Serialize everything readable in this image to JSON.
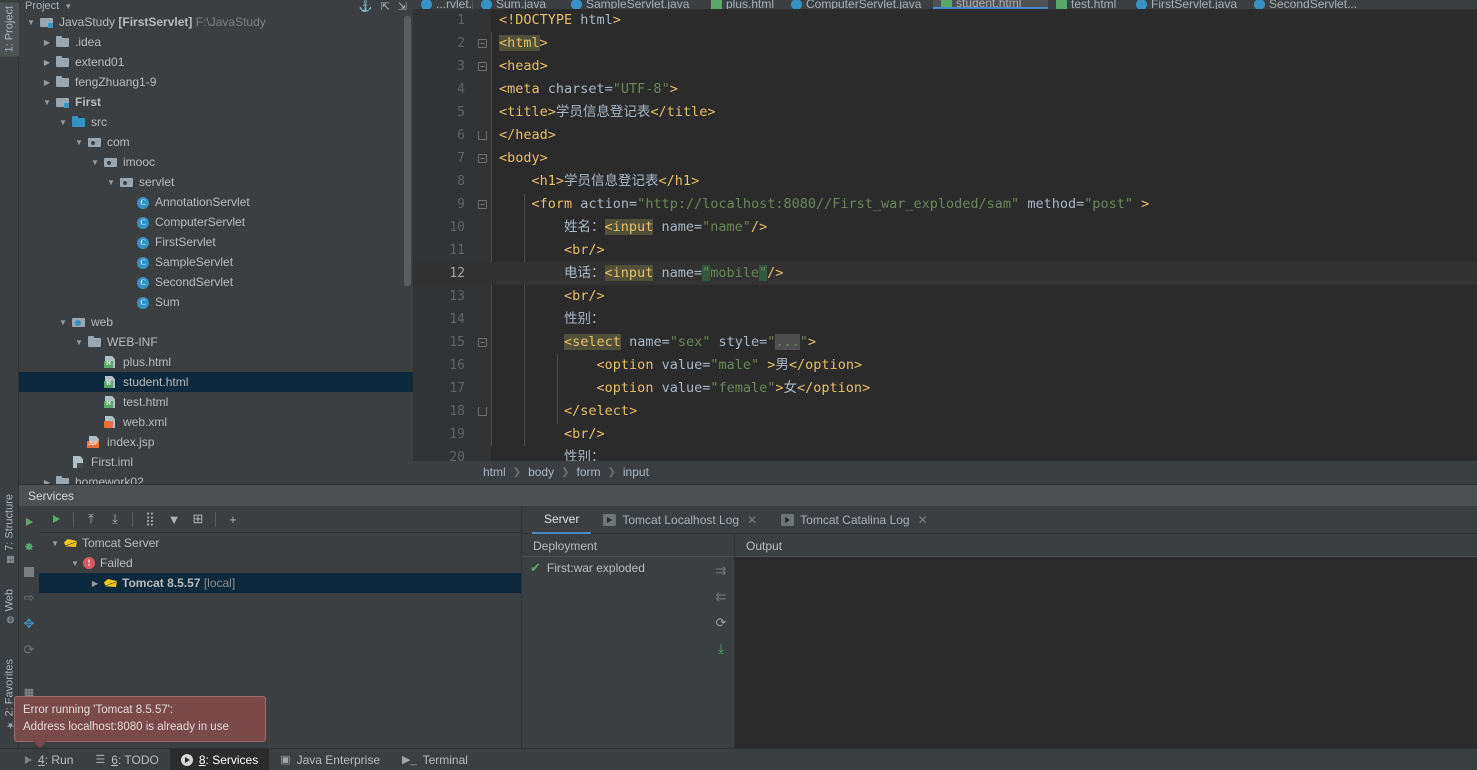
{
  "left_strip": {
    "top_tab": {
      "label": "1: Project",
      "selected": true
    },
    "bottom_tabs": [
      {
        "label": "7: Structure",
        "icon": "structure-icon"
      },
      {
        "label": "Web",
        "icon": "web-icon"
      },
      {
        "label": "2: Favorites",
        "icon": "star-icon"
      }
    ]
  },
  "project": {
    "title": "Project",
    "tree": [
      {
        "indent": 0,
        "arrow": "down",
        "icon": "module-icon",
        "label": "JavaStudy ",
        "bold": "[FirstServlet]",
        "dim": "F:\\JavaStudy"
      },
      {
        "indent": 1,
        "arrow": "right",
        "icon": "folder-icon",
        "label": ".idea"
      },
      {
        "indent": 1,
        "arrow": "right",
        "icon": "folder-icon",
        "label": "extend01"
      },
      {
        "indent": 1,
        "arrow": "right",
        "icon": "folder-icon",
        "label": "fengZhuang1-9"
      },
      {
        "indent": 1,
        "arrow": "down",
        "icon": "module-icon",
        "label": "First",
        "boldLabel": true
      },
      {
        "indent": 2,
        "arrow": "down",
        "icon": "folder-blue-icon",
        "label": "src"
      },
      {
        "indent": 3,
        "arrow": "down",
        "icon": "package-icon",
        "label": "com"
      },
      {
        "indent": 4,
        "arrow": "down",
        "icon": "package-icon",
        "label": "imooc"
      },
      {
        "indent": 5,
        "arrow": "down",
        "icon": "package-icon",
        "label": "servlet"
      },
      {
        "indent": 6,
        "arrow": "none",
        "icon": "java-class-icon",
        "label": "AnnotationServlet"
      },
      {
        "indent": 6,
        "arrow": "none",
        "icon": "java-class-icon",
        "label": "ComputerServlet"
      },
      {
        "indent": 6,
        "arrow": "none",
        "icon": "java-class-icon",
        "label": "FirstServlet"
      },
      {
        "indent": 6,
        "arrow": "none",
        "icon": "java-class-icon",
        "label": "SampleServlet"
      },
      {
        "indent": 6,
        "arrow": "none",
        "icon": "java-class-icon",
        "label": "SecondServlet"
      },
      {
        "indent": 6,
        "arrow": "none",
        "icon": "java-class-icon",
        "label": "Sum"
      },
      {
        "indent": 2,
        "arrow": "down",
        "icon": "web-root-icon",
        "label": "web"
      },
      {
        "indent": 3,
        "arrow": "down",
        "icon": "folder-icon",
        "label": "WEB-INF"
      },
      {
        "indent": 4,
        "arrow": "none",
        "icon": "html-file-icon",
        "label": "plus.html"
      },
      {
        "indent": 4,
        "arrow": "none",
        "icon": "html-file-icon",
        "label": "student.html",
        "selected": true
      },
      {
        "indent": 4,
        "arrow": "none",
        "icon": "html-file-icon",
        "label": "test.html"
      },
      {
        "indent": 4,
        "arrow": "none",
        "icon": "xml-file-icon",
        "label": "web.xml"
      },
      {
        "indent": 3,
        "arrow": "none",
        "icon": "jsp-file-icon",
        "label": "index.jsp"
      },
      {
        "indent": 2,
        "arrow": "none",
        "icon": "iml-file-icon",
        "label": "First.iml"
      },
      {
        "indent": 1,
        "arrow": "right",
        "icon": "folder-icon",
        "label": "homework02"
      }
    ]
  },
  "editor_tabs": [
    {
      "label": "...rvlet.java",
      "icon": "java-class-icon",
      "active": false
    },
    {
      "label": "Sum.java",
      "icon": "java-class-icon",
      "active": false
    },
    {
      "label": "SampleServlet.java",
      "icon": "java-class-icon",
      "active": false
    },
    {
      "label": "plus.html",
      "icon": "html-file-icon",
      "active": false
    },
    {
      "label": "ComputerServlet.java",
      "icon": "java-class-icon",
      "active": false
    },
    {
      "label": "student.html",
      "icon": "html-file-icon",
      "active": true
    },
    {
      "label": "test.html",
      "icon": "html-file-icon",
      "active": false
    },
    {
      "label": "FirstServlet.java",
      "icon": "java-class-icon",
      "active": false
    },
    {
      "label": "SecondServlet...",
      "icon": "java-class-icon",
      "active": false
    }
  ],
  "code": {
    "current_line": 12,
    "lines": [
      {
        "n": 1,
        "text": "<!DOCTYPE html>"
      },
      {
        "n": 2,
        "text": "<html>",
        "fold": "minus"
      },
      {
        "n": 3,
        "text": "<head>",
        "fold": "minus"
      },
      {
        "n": 4,
        "text": "<meta charset=\"UTF-8\">"
      },
      {
        "n": 5,
        "text": "<title>学员信息登记表</title>"
      },
      {
        "n": 6,
        "text": "</head>",
        "fold": "end"
      },
      {
        "n": 7,
        "text": "<body>",
        "fold": "minus"
      },
      {
        "n": 8,
        "text": "    <h1>学员信息登记表</h1>"
      },
      {
        "n": 9,
        "text": "    <form action=\"http://localhost:8080//First_war_exploded/sam\" method=\"post\" >",
        "fold": "minus"
      },
      {
        "n": 10,
        "text": "        姓名：<input name=\"name\"/>"
      },
      {
        "n": 11,
        "text": "        <br/>"
      },
      {
        "n": 12,
        "text": "        电话：<input name=\"mobile\"/>"
      },
      {
        "n": 13,
        "text": "        <br/>"
      },
      {
        "n": 14,
        "text": "        性别："
      },
      {
        "n": 15,
        "text": "        <select name=\"sex\" style=\"...\">",
        "fold": "minus"
      },
      {
        "n": 16,
        "text": "            <option value=\"male\" >男</option>"
      },
      {
        "n": 17,
        "text": "            <option value=\"female\">女</option>"
      },
      {
        "n": 18,
        "text": "        </select>",
        "fold": "end"
      },
      {
        "n": 19,
        "text": "        <br/>"
      },
      {
        "n": 20,
        "text": "        性别："
      }
    ]
  },
  "breadcrumb": [
    "html",
    "body",
    "form",
    "input"
  ],
  "services": {
    "title": "Services",
    "toolbar_buttons": [
      {
        "name": "run-button",
        "glyph": "▶"
      },
      {
        "name": "expand-all-button",
        "glyph": "⤒"
      },
      {
        "name": "collapse-all-button",
        "glyph": "⤓"
      },
      {
        "name": "group-by-button",
        "glyph": "⣿"
      },
      {
        "name": "filter-button",
        "glyph": "▼"
      },
      {
        "name": "add-tab-button",
        "glyph": "⊞"
      },
      {
        "name": "add-service-button",
        "glyph": "+"
      }
    ],
    "sidebar_buttons": [
      {
        "name": "run-button",
        "glyph": "▶"
      },
      {
        "name": "debug-button",
        "glyph": "🐞"
      },
      {
        "name": "stop-button",
        "glyph": "■"
      },
      {
        "name": "deploy-button",
        "glyph": "⇨"
      },
      {
        "name": "update-button",
        "glyph": "✥"
      },
      {
        "name": "restart-button",
        "glyph": "⟳"
      },
      {
        "name": "layout-button",
        "glyph": "▦"
      }
    ],
    "tree": [
      {
        "indent": 0,
        "arrow": "down",
        "icon": "tomcat-icon",
        "label": "Tomcat Server"
      },
      {
        "indent": 1,
        "arrow": "down",
        "icon": "error-icon",
        "label": "Failed"
      },
      {
        "indent": 2,
        "arrow": "right",
        "icon": "tomcat-icon",
        "label": "Tomcat 8.5.57",
        "dim": "[local]",
        "bold": true,
        "selected": true
      }
    ],
    "tabs": [
      {
        "label": "Server",
        "active": true,
        "closable": false
      },
      {
        "label": "Tomcat Localhost Log",
        "active": false,
        "closable": true,
        "icon": "run-tab-icon"
      },
      {
        "label": "Tomcat Catalina Log",
        "active": false,
        "closable": true,
        "icon": "run-tab-icon"
      }
    ],
    "deployment": {
      "title": "Deployment",
      "items": [
        {
          "label": "First:war exploded",
          "status": "ok"
        }
      ],
      "tool_buttons": [
        {
          "name": "deploy-all-icon",
          "glyph": "⇉"
        },
        {
          "name": "undeploy-icon",
          "glyph": "⇇"
        },
        {
          "name": "redeploy-icon",
          "glyph": "⟳"
        },
        {
          "name": "download-icon",
          "glyph": "⤓"
        }
      ]
    },
    "output": {
      "title": "Output",
      "text": ""
    }
  },
  "tooltip": {
    "line1": "Error running 'Tomcat 8.5.57':",
    "line2": "Address localhost:8080 is already in use"
  },
  "statusbar": [
    {
      "label": "4: Run",
      "num": "4",
      "rest": ": Run",
      "icon": "play-icon",
      "active": false
    },
    {
      "label": "6: TODO",
      "num": "6",
      "rest": ": TODO",
      "icon": "todo-icon",
      "active": false
    },
    {
      "label": "8: Services",
      "num": "8",
      "rest": ": Services",
      "icon": "services-icon",
      "active": true
    },
    {
      "label": "Java Enterprise",
      "num": "",
      "rest": "Java Enterprise",
      "icon": "java-ee-icon",
      "active": false
    },
    {
      "label": "Terminal",
      "num": "",
      "rest": "Terminal",
      "icon": "terminal-icon",
      "active": false
    }
  ],
  "colors": {
    "bg": "#3c3f41",
    "editor_bg": "#2b2b2b",
    "selection": "#0d293e",
    "accent": "#4a88c7",
    "error": "#db5860",
    "ok": "#59a869",
    "tag": "#e8bf6a",
    "string": "#6a8759",
    "text": "#a9b7c6"
  }
}
